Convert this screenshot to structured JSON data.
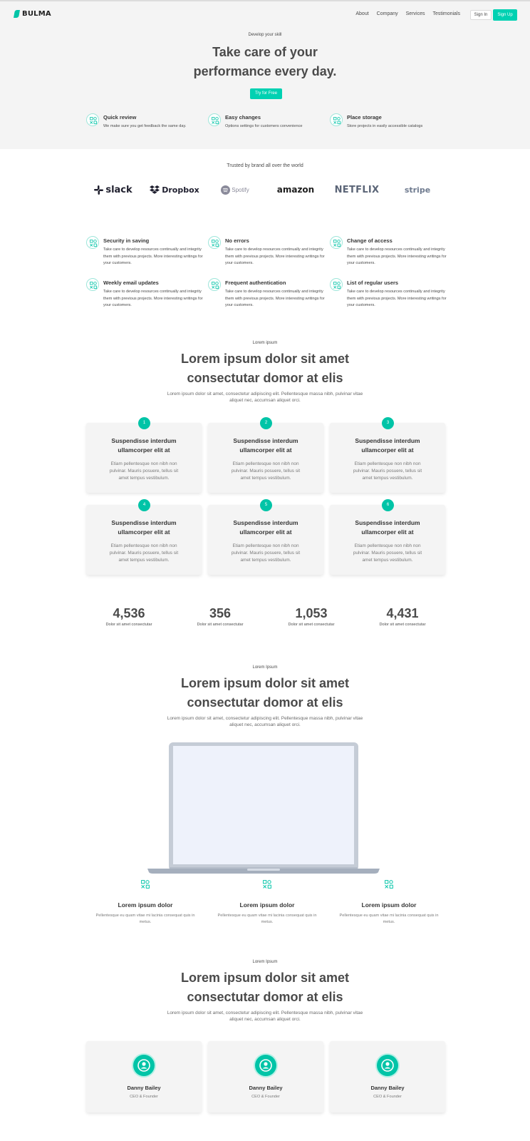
{
  "nav": {
    "logo": "BULMA",
    "links": [
      "About",
      "Company",
      "Services",
      "Testimonials"
    ],
    "sign_in": "Sign In",
    "sign_up": "Sign Up"
  },
  "hero": {
    "eyebrow": "Develop your skill",
    "title_line1": "Take care of your",
    "title_line2": "performance every day.",
    "cta": "Try for Free",
    "features": [
      {
        "title": "Quick review",
        "desc": "We make sure you get feedback the same day."
      },
      {
        "title": "Easy changes",
        "desc": "Options settings for customers convenience"
      },
      {
        "title": "Place storage",
        "desc": "Store projects in easily accessible catalogs"
      }
    ]
  },
  "trusted": {
    "label": "Trusted by brand all over the world",
    "brands": [
      "slack",
      "Dropbox",
      "Spotify",
      "amazon",
      "NETFLIX",
      "stripe"
    ]
  },
  "features": [
    {
      "title": "Security in saving",
      "desc": "Take care to develop resources continually and integrity them with previous projects. More interesting writings for your customers."
    },
    {
      "title": "No errors",
      "desc": "Take care to develop resources continually and integrity them with previous projects. More interesting writings for your customers."
    },
    {
      "title": "Change of access",
      "desc": "Take care to develop resources continually and integrity them with previous projects. More interesting writings for your customers."
    },
    {
      "title": "Weekly email updates",
      "desc": "Take care to develop resources continually and integrity them with previous projects. More interesting writings for your customers."
    },
    {
      "title": "Frequent authentication",
      "desc": "Take care to develop resources continually and integrity them with previous projects. More interesting writings for your customers."
    },
    {
      "title": "List of regular users",
      "desc": "Take care to develop resources continually and integrity them with previous projects. More interesting writings for your customers."
    }
  ],
  "steps_section": {
    "eyebrow": "Lorem ipsum",
    "title_line1": "Lorem ipsum dolor sit amet",
    "title_line2": "consectutar domor at elis",
    "subtitle_line1": "Lorem ipsum dolor sit amet, consectetur adipiscing elit. Pellentesque massa nibh, pulvinar vitae",
    "subtitle_line2": "aliquet nec, accumsan aliquet orci.",
    "cards": [
      {
        "num": "1",
        "title_line1": "Suspendisse interdum",
        "title_line2": "ullamcorper elit at",
        "text_line1": "Etiam pellentesque non nibh non",
        "text_line2": "pulvinar. Mauris posuere, tellus sit",
        "text_line3": "amet tempus vestibulum."
      },
      {
        "num": "2",
        "title_line1": "Suspendisse interdum",
        "title_line2": "ullamcorper elit at",
        "text_line1": "Etiam pellentesque non nibh non",
        "text_line2": "pulvinar. Mauris posuere, tellus sit",
        "text_line3": "amet tempus vestibulum."
      },
      {
        "num": "3",
        "title_line1": "Suspendisse interdum",
        "title_line2": "ullamcorper elit at",
        "text_line1": "Etiam pellentesque non nibh non",
        "text_line2": "pulvinar. Mauris posuere, tellus sit",
        "text_line3": "amet tempus vestibulum."
      },
      {
        "num": "4",
        "title_line1": "Suspendisse interdum",
        "title_line2": "ullamcorper elit at",
        "text_line1": "Etiam pellentesque non nibh non",
        "text_line2": "pulvinar. Mauris posuere, tellus sit",
        "text_line3": "amet tempus vestibulum."
      },
      {
        "num": "5",
        "title_line1": "Suspendisse interdum",
        "title_line2": "ullamcorper elit at",
        "text_line1": "Etiam pellentesque non nibh non",
        "text_line2": "pulvinar. Mauris posuere, tellus sit",
        "text_line3": "amet tempus vestibulum."
      },
      {
        "num": "6",
        "title_line1": "Suspendisse interdum",
        "title_line2": "ullamcorper elit at",
        "text_line1": "Etiam pellentesque non nibh non",
        "text_line2": "pulvinar. Mauris posuere, tellus sit",
        "text_line3": "amet tempus vestibulum."
      }
    ]
  },
  "stats": [
    {
      "value": "4,536",
      "label": "Dolor sit amet consectutar"
    },
    {
      "value": "356",
      "label": "Dolor sit amet consectutar"
    },
    {
      "value": "1,053",
      "label": "Dolor sit amet consectutar"
    },
    {
      "value": "4,431",
      "label": "Dolor sit amet consectutar"
    }
  ],
  "device_section": {
    "eyebrow": "Lorem Ipsum",
    "title_line1": "Lorem ipsum dolor sit amet",
    "title_line2": "consectutar domor at elis",
    "subtitle_line1": "Lorem ipsum dolor sit amet, consectetur adipiscing elit. Pellentesque massa nibh, pulvinar vitae",
    "subtitle_line2": "aliquet nec, accumsan aliquet orci.",
    "items": [
      {
        "title": "Lorem ipsum dolor",
        "desc_line1": "Pellentesque eu quam vitae mi lacinia consequat quis in",
        "desc_line2": "metus."
      },
      {
        "title": "Lorem ipsum dolor",
        "desc_line1": "Pellentesque eu quam vitae mi lacinia consequat quis in",
        "desc_line2": "metus."
      },
      {
        "title": "Lorem ipsum dolor",
        "desc_line1": "Pellentesque eu quam vitae mi lacinia consequat quis in",
        "desc_line2": "metus."
      }
    ]
  },
  "team_section": {
    "eyebrow": "Lorem Ipsum",
    "title_line1": "Lorem ipsum dolor sit amet",
    "title_line2": "consectutar domor at elis",
    "subtitle_line1": "Lorem ipsum dolor sit amet, consectetur adipiscing elit. Pellentesque massa nibh, pulvinar vitae",
    "subtitle_line2": "aliquet nec, accumsan aliquet orci.",
    "members": [
      {
        "name": "Danny Bailey",
        "role": "CEO & Founder"
      },
      {
        "name": "Danny Bailey",
        "role": "CEO & Founder"
      },
      {
        "name": "Danny Bailey",
        "role": "CEO & Founder"
      }
    ]
  },
  "colors": {
    "accent": "#00d1b2",
    "hero_bg": "#f4f4f4",
    "text": "#4a4a4a"
  },
  "icons": [
    "feature-grid-icon",
    "user-icon",
    "dropbox-icon",
    "slack-icon",
    "spotify-icon"
  ]
}
